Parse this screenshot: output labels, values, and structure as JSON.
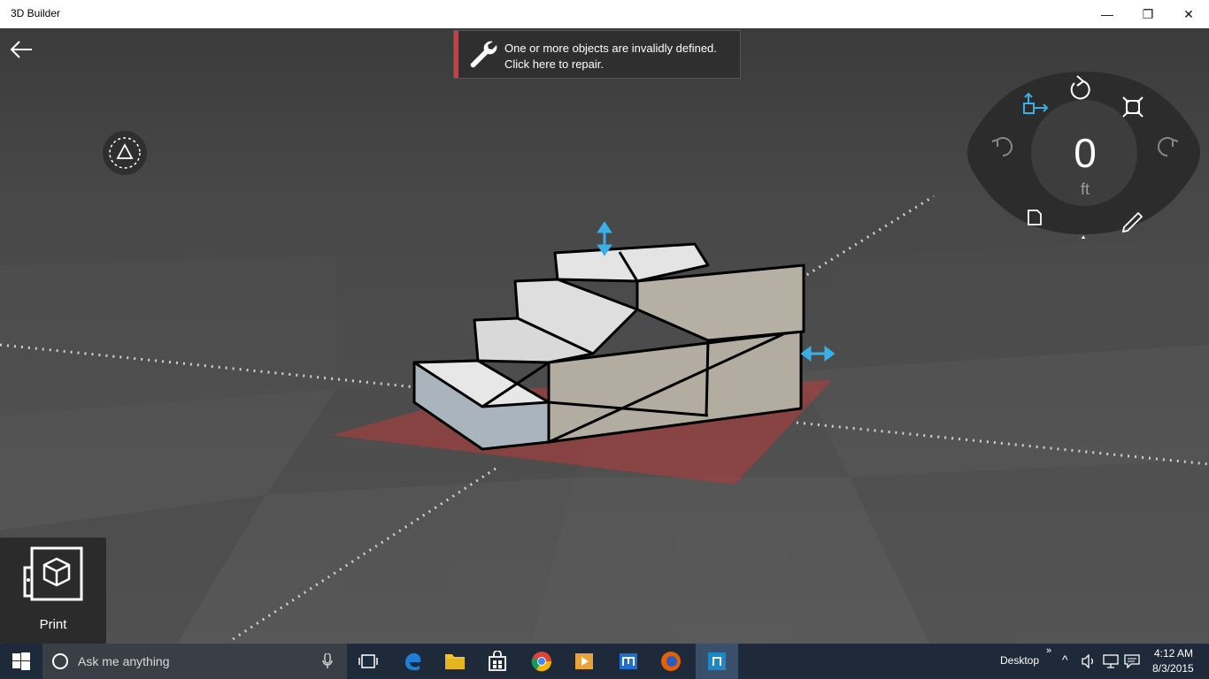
{
  "window": {
    "title": "3D Builder",
    "minimize_glyph": "—",
    "maximize_glyph": "❐",
    "close_glyph": "✕"
  },
  "repair_banner": {
    "message": "One or more objects are invalidly defined. Click here to repair.",
    "accent_color": "#d9363e",
    "icon": "wrench-icon"
  },
  "control_wheel": {
    "value": "0",
    "unit": "ft",
    "icons": [
      "move-icon",
      "rotate-icon",
      "scale-icon",
      "undo-icon",
      "redo-icon",
      "file-icon",
      "mesh-icon",
      "edit-icon"
    ],
    "accent_color": "#3ab0e6"
  },
  "print_tile": {
    "label": "Print",
    "icon": "print-3d-icon"
  },
  "taskbar": {
    "search_placeholder": "Ask me anything",
    "apps": [
      "task-view-icon",
      "edge-icon",
      "file-explorer-icon",
      "store-icon",
      "chrome-icon",
      "media-icon",
      "app-m-icon",
      "firefox-icon",
      "3d-builder-icon"
    ],
    "desktop_label": "Desktop",
    "time": "4:12 AM",
    "date": "8/3/2015"
  }
}
